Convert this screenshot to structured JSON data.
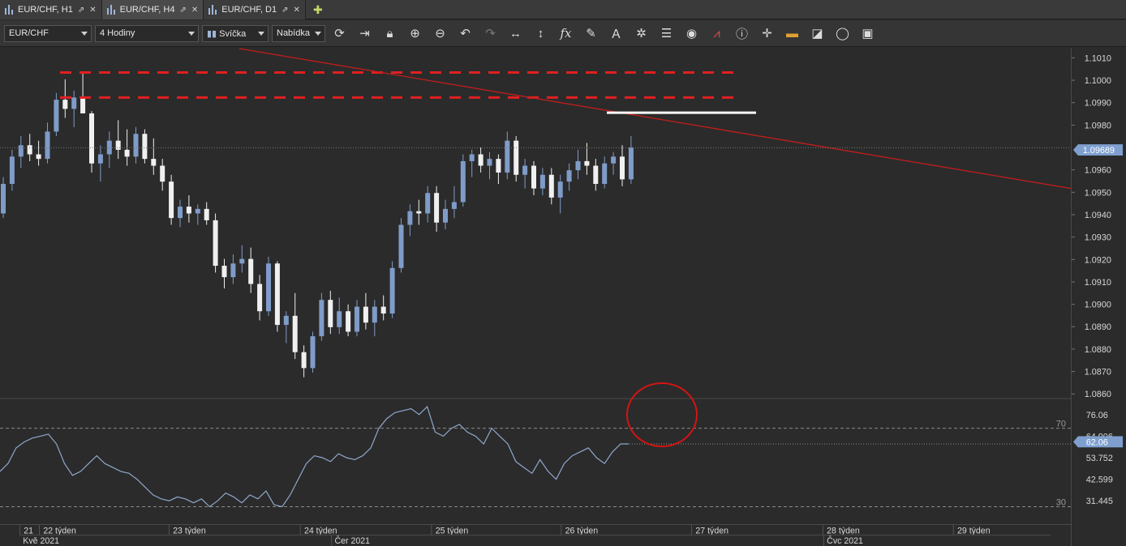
{
  "tabs": [
    {
      "label": "EUR/CHF, H1"
    },
    {
      "label": "EUR/CHF, H4"
    },
    {
      "label": "EUR/CHF, D1"
    }
  ],
  "toolbar": {
    "symbol": "EUR/CHF",
    "timeframe": "4 Hodiny",
    "chart_type": "Svíčka",
    "price_side": "Nabídka",
    "fx_label": "fx"
  },
  "price_axis": {
    "ticks": [
      "1.1010",
      "1.1000",
      "1.0990",
      "1.0980",
      "1.0960",
      "1.0950",
      "1.0940",
      "1.0930",
      "1.0920",
      "1.0910",
      "1.0900",
      "1.0890",
      "1.0880",
      "1.0870",
      "1.0860"
    ],
    "current_label": "1.09689"
  },
  "rsi_axis": {
    "ticks": [
      "76.06",
      "64.906",
      "53.752",
      "42.599",
      "31.445"
    ],
    "current_label": "62.06",
    "level_high": "70",
    "level_low": "30"
  },
  "time_axis": {
    "week_labels": [
      "21",
      "22 týden",
      "23 týden",
      "24 týden",
      "25 týden",
      "26 týden",
      "27 týden",
      "28 týden",
      "29 týden"
    ],
    "month_labels": [
      "Kvě 2021",
      "Čer 2021",
      "Čvc 2021"
    ]
  },
  "colors": {
    "background": "#2b2b2b",
    "bull": "#7f9cc9",
    "bear": "#f0f0f0",
    "resistance": "#e02020",
    "trendline": "#c41d1d",
    "marker": "#ffffff",
    "rsi": "#8fa8cc",
    "highlight_circle": "#d41414",
    "price_label": "#7fa0cf"
  },
  "chart_data": {
    "type": "candlestick",
    "price_range": [
      1.086,
      1.1014
    ],
    "resistance_levels": [
      1.1002,
      1.0991
    ],
    "trendline": {
      "from_price": 1.10125,
      "to_price": 1.0951
    },
    "marker_level": 1.09843,
    "current_price": 1.09689,
    "candles": [
      [
        1.094,
        1.0956,
        1.0938,
        1.0953
      ],
      [
        1.0953,
        1.0968,
        1.095,
        1.0965
      ],
      [
        1.0965,
        1.0974,
        1.096,
        1.097
      ],
      [
        1.097,
        1.0975,
        1.0963,
        1.0966
      ],
      [
        1.0966,
        1.0972,
        1.0961,
        1.0964
      ],
      [
        1.0964,
        1.098,
        1.0962,
        1.0976
      ],
      [
        1.0976,
        1.0993,
        1.0974,
        1.099
      ],
      [
        1.099,
        1.0999,
        1.0982,
        1.0986
      ],
      [
        1.0986,
        1.0994,
        1.0978,
        1.0991
      ],
      [
        1.0991,
        1.1002,
        1.0988,
        1.0984
      ],
      [
        1.0984,
        1.0985,
        1.0958,
        1.0962
      ],
      [
        1.0962,
        1.097,
        1.0954,
        1.0966
      ],
      [
        1.0966,
        1.0976,
        1.096,
        1.0972
      ],
      [
        1.0972,
        1.0981,
        1.0964,
        1.0968
      ],
      [
        1.0968,
        1.0977,
        1.0961,
        1.0965
      ],
      [
        1.0965,
        1.0978,
        1.0962,
        1.0975
      ],
      [
        1.0975,
        1.0977,
        1.0962,
        1.0964
      ],
      [
        1.0964,
        1.0973,
        1.0957,
        1.0961
      ],
      [
        1.0961,
        1.0964,
        1.095,
        1.0954
      ],
      [
        1.0954,
        1.0957,
        1.0935,
        1.0938
      ],
      [
        1.0938,
        1.0946,
        1.0934,
        1.0943
      ],
      [
        1.0943,
        1.0948,
        1.0936,
        1.094
      ],
      [
        1.094,
        1.0944,
        1.0935,
        1.0942
      ],
      [
        1.0942,
        1.0945,
        1.0935,
        1.0937
      ],
      [
        1.0937,
        1.094,
        1.0914,
        1.0917
      ],
      [
        1.0917,
        1.092,
        1.0907,
        1.0912
      ],
      [
        1.0912,
        1.0922,
        1.0909,
        1.0918
      ],
      [
        1.0918,
        1.0926,
        1.0914,
        1.092
      ],
      [
        1.092,
        1.0925,
        1.0905,
        1.0909
      ],
      [
        1.0909,
        1.0913,
        1.0893,
        1.0897
      ],
      [
        1.0897,
        1.0921,
        1.0895,
        1.0918
      ],
      [
        1.0918,
        1.0919,
        1.0888,
        1.0891
      ],
      [
        1.0891,
        1.0897,
        1.0883,
        1.0895
      ],
      [
        1.0895,
        1.0905,
        1.0876,
        1.0879
      ],
      [
        1.0879,
        1.0882,
        1.0868,
        1.0872
      ],
      [
        1.0872,
        1.0888,
        1.087,
        1.0886
      ],
      [
        1.0886,
        1.0905,
        1.0884,
        1.0902
      ],
      [
        1.0902,
        1.0906,
        1.0887,
        1.089
      ],
      [
        1.089,
        1.0903,
        1.0887,
        1.0897
      ],
      [
        1.0897,
        1.09,
        1.0886,
        1.0888
      ],
      [
        1.0888,
        1.0902,
        1.0886,
        1.0899
      ],
      [
        1.0899,
        1.0905,
        1.0889,
        1.0892
      ],
      [
        1.0892,
        1.0902,
        1.0886,
        1.0899
      ],
      [
        1.0899,
        1.0904,
        1.0893,
        1.0896
      ],
      [
        1.0896,
        1.0919,
        1.0894,
        1.0916
      ],
      [
        1.0916,
        1.0938,
        1.0914,
        1.0935
      ],
      [
        1.0935,
        1.0944,
        1.093,
        1.0941
      ],
      [
        1.0941,
        1.0946,
        1.0935,
        1.094
      ],
      [
        1.094,
        1.0952,
        1.0936,
        1.0949
      ],
      [
        1.0949,
        1.0952,
        1.0932,
        1.0936
      ],
      [
        1.0936,
        1.0946,
        1.0933,
        1.0942
      ],
      [
        1.0942,
        1.0952,
        1.0938,
        1.0945
      ],
      [
        1.0945,
        1.0966,
        1.0943,
        1.0963
      ],
      [
        1.0963,
        1.0968,
        1.0956,
        1.0966
      ],
      [
        1.0966,
        1.0969,
        1.0958,
        1.0961
      ],
      [
        1.0961,
        1.0967,
        1.0955,
        1.0964
      ],
      [
        1.0964,
        1.0966,
        1.0953,
        1.0958
      ],
      [
        1.0958,
        1.0976,
        1.0955,
        1.0972
      ],
      [
        1.0972,
        1.0974,
        1.0954,
        1.0957
      ],
      [
        1.0957,
        1.0964,
        1.0951,
        1.0961
      ],
      [
        1.0961,
        1.0963,
        1.0948,
        1.0951
      ],
      [
        1.0951,
        1.096,
        1.0948,
        1.0957
      ],
      [
        1.0957,
        1.096,
        1.0944,
        1.0947
      ],
      [
        1.0947,
        1.0957,
        1.094,
        1.0954
      ],
      [
        1.0954,
        1.0962,
        1.095,
        1.0959
      ],
      [
        1.0959,
        1.0968,
        1.0955,
        1.0963
      ],
      [
        1.0963,
        1.0971,
        1.0957,
        1.0961
      ],
      [
        1.0961,
        1.0964,
        1.095,
        1.0953
      ],
      [
        1.0953,
        1.0965,
        1.0951,
        1.0962
      ],
      [
        1.0962,
        1.0967,
        1.0957,
        1.0965
      ],
      [
        1.0965,
        1.097,
        1.0952,
        1.0955
      ],
      [
        1.0955,
        1.0974,
        1.0953,
        1.0969
      ]
    ],
    "rsi": {
      "values": [
        48,
        52,
        60,
        63,
        65,
        66,
        67,
        62,
        52,
        46,
        48,
        52,
        56,
        52,
        50,
        48,
        47,
        44,
        40,
        36,
        34,
        33,
        35,
        34,
        32,
        34,
        30,
        33,
        37,
        35,
        32,
        36,
        34,
        38,
        31,
        30,
        36,
        44,
        52,
        56,
        55,
        53,
        57,
        55,
        54,
        56,
        60,
        70,
        75,
        78,
        79,
        80,
        77,
        81,
        68,
        66,
        70,
        72,
        68,
        66,
        62,
        70,
        66,
        62,
        53,
        50,
        47,
        54,
        48,
        44,
        52,
        56,
        58,
        60,
        55,
        52,
        58,
        62,
        62
      ],
      "levels": [
        70,
        30
      ],
      "range": [
        25,
        86
      ]
    }
  }
}
